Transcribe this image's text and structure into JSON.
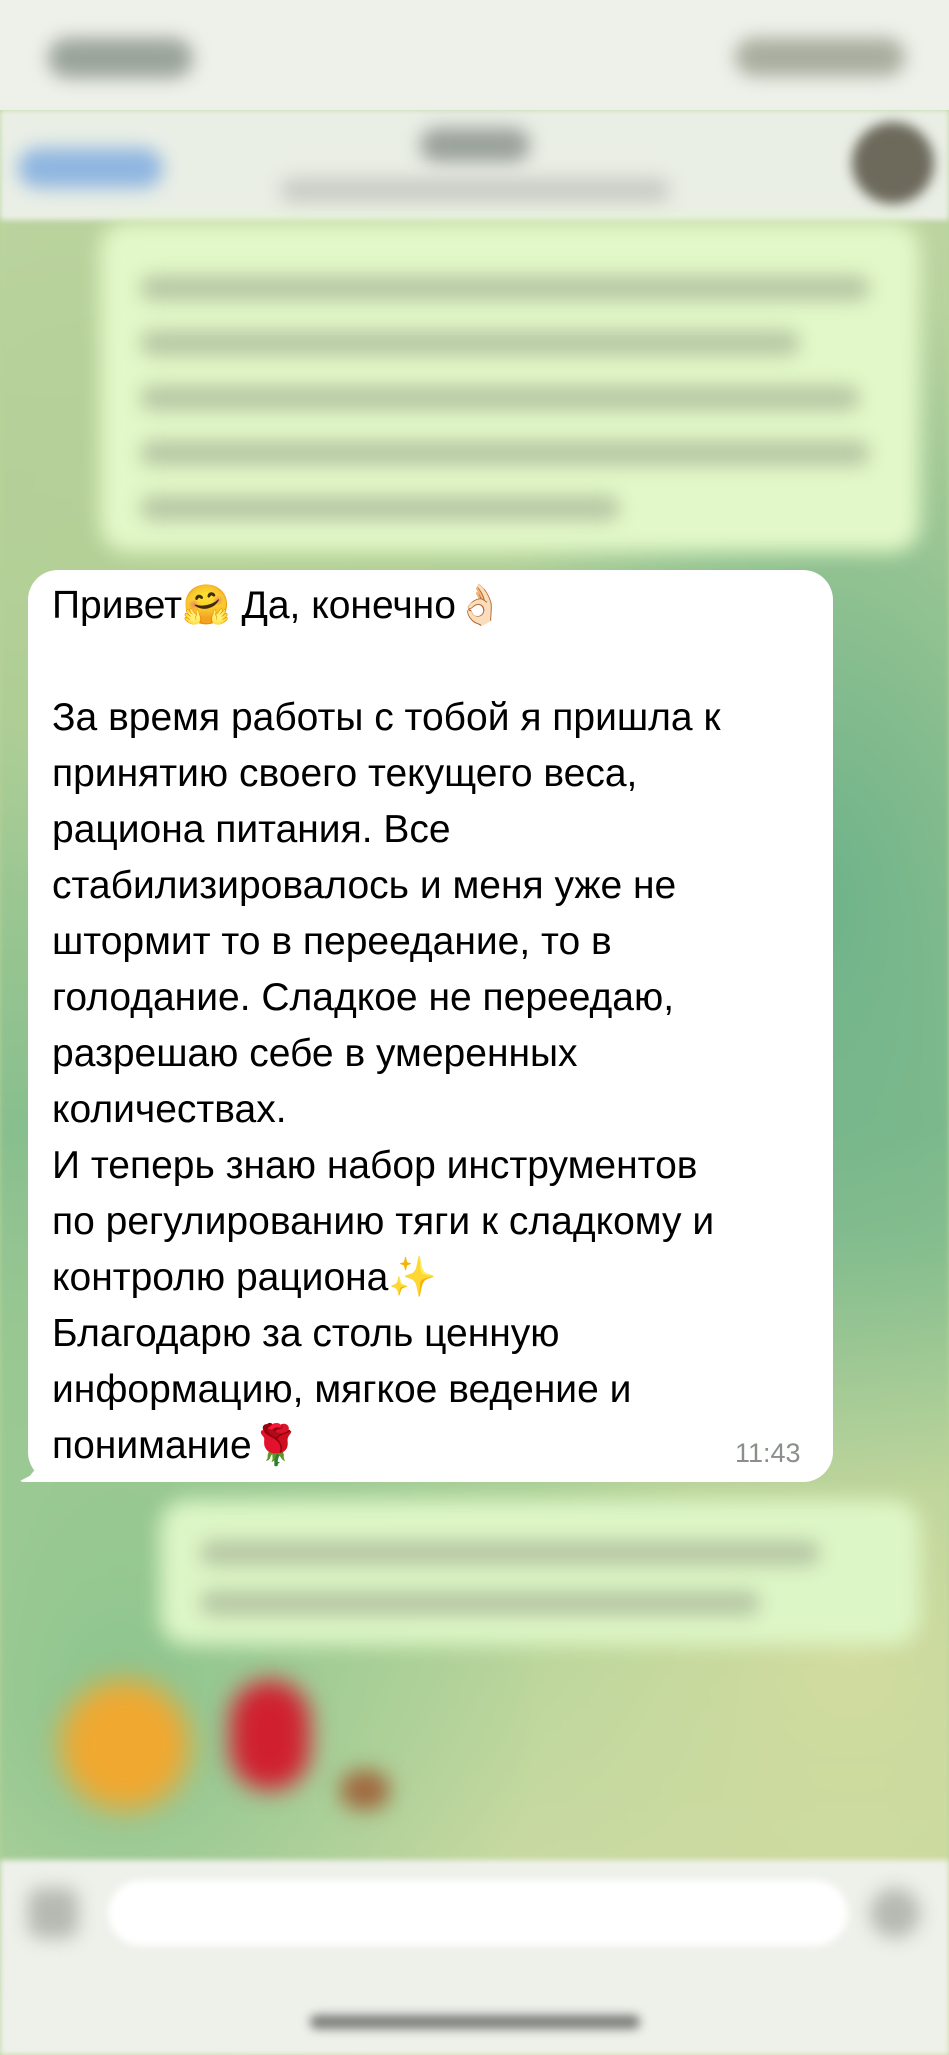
{
  "chat": {
    "incoming_message": {
      "text": "Привет🤗 Да, конечно👌🏻\n\nЗа время работы с тобой я пришла к\nпринятию своего текущего веса,\nрациона питания. Все\nстабилизировалось и меня уже не\nштормит то в переедание, то в\nголодание. Сладкое не переедаю,\nразрешаю себе в умеренных\nколичествах.\nИ теперь знаю набор инструментов\nпо регулированию тяги к сладкому и\nконтролю рациона✨\nБлагодарю за столь ценную\nинформацию, мягкое ведение и\nпонимание🌹",
      "time": "11:43"
    }
  },
  "colors": {
    "incoming_bubble": "#ffffff",
    "outgoing_bubble": "#e3f8c8",
    "timestamp": "#8a8f89"
  },
  "icons": [
    "back-icon",
    "avatar",
    "attach-icon",
    "microphone-icon"
  ]
}
